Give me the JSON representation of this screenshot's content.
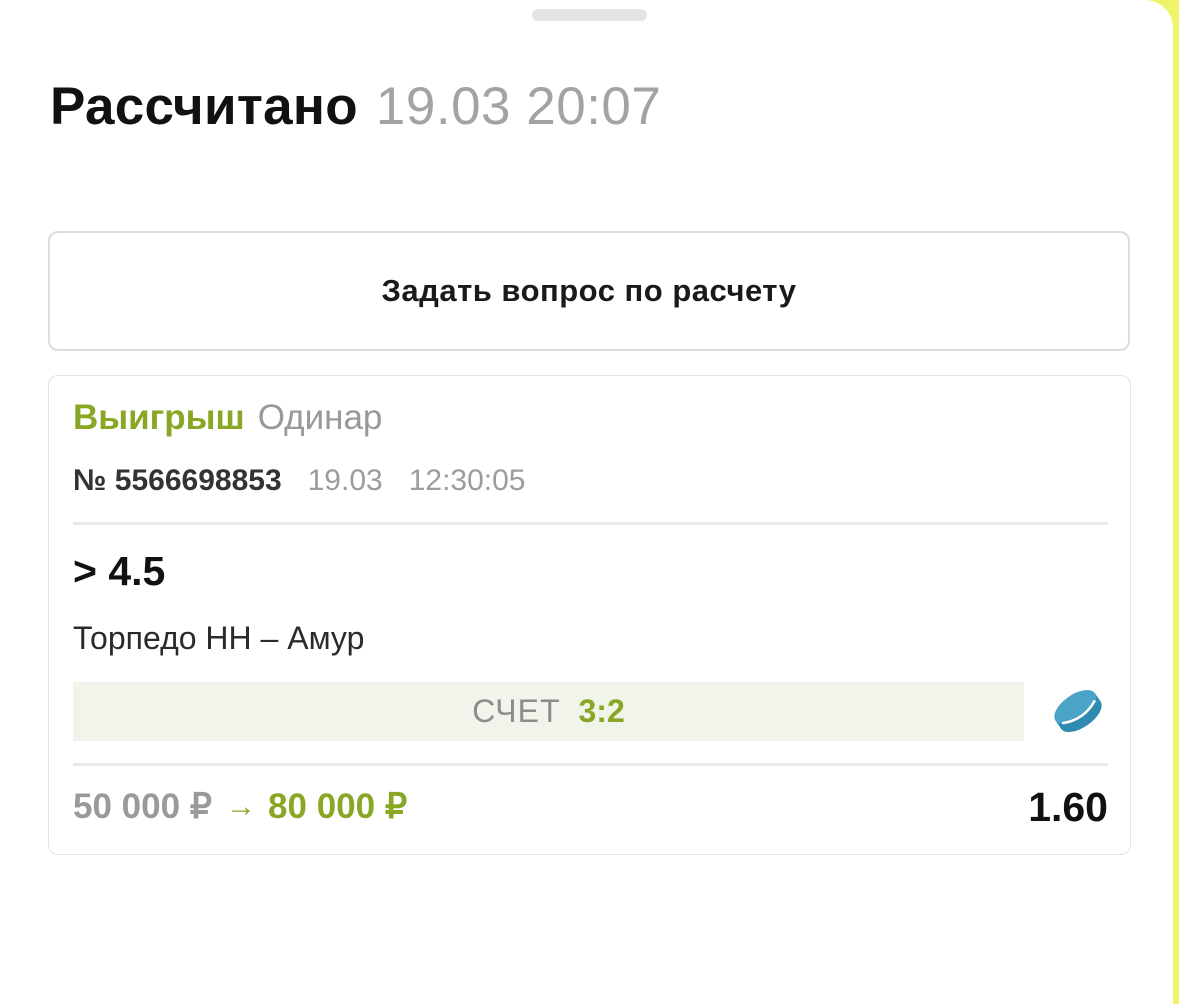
{
  "header": {
    "title": "Рассчитано",
    "datetime": "19.03 20:07"
  },
  "actions": {
    "ask_question_label": "Задать вопрос по расчету"
  },
  "bet": {
    "status": "Выигрыш",
    "type": "Одинар",
    "number": "№ 5566698853",
    "date": "19.03",
    "time": "12:30:05",
    "outcome": "> 4.5",
    "match": "Торпедо НН – Амур",
    "score_label": "СЧЕТ",
    "score_value": "3:2",
    "sport_icon": "hockey-puck-icon",
    "stake": "50 000 ₽",
    "arrow": "→",
    "payout": "80 000 ₽",
    "odds": "1.60"
  },
  "colors": {
    "accent_green": "#88a725",
    "score_bar_bg": "#f1f4ea",
    "puck_blue": "#4ba3c7",
    "side_strip": "#eef36a"
  }
}
